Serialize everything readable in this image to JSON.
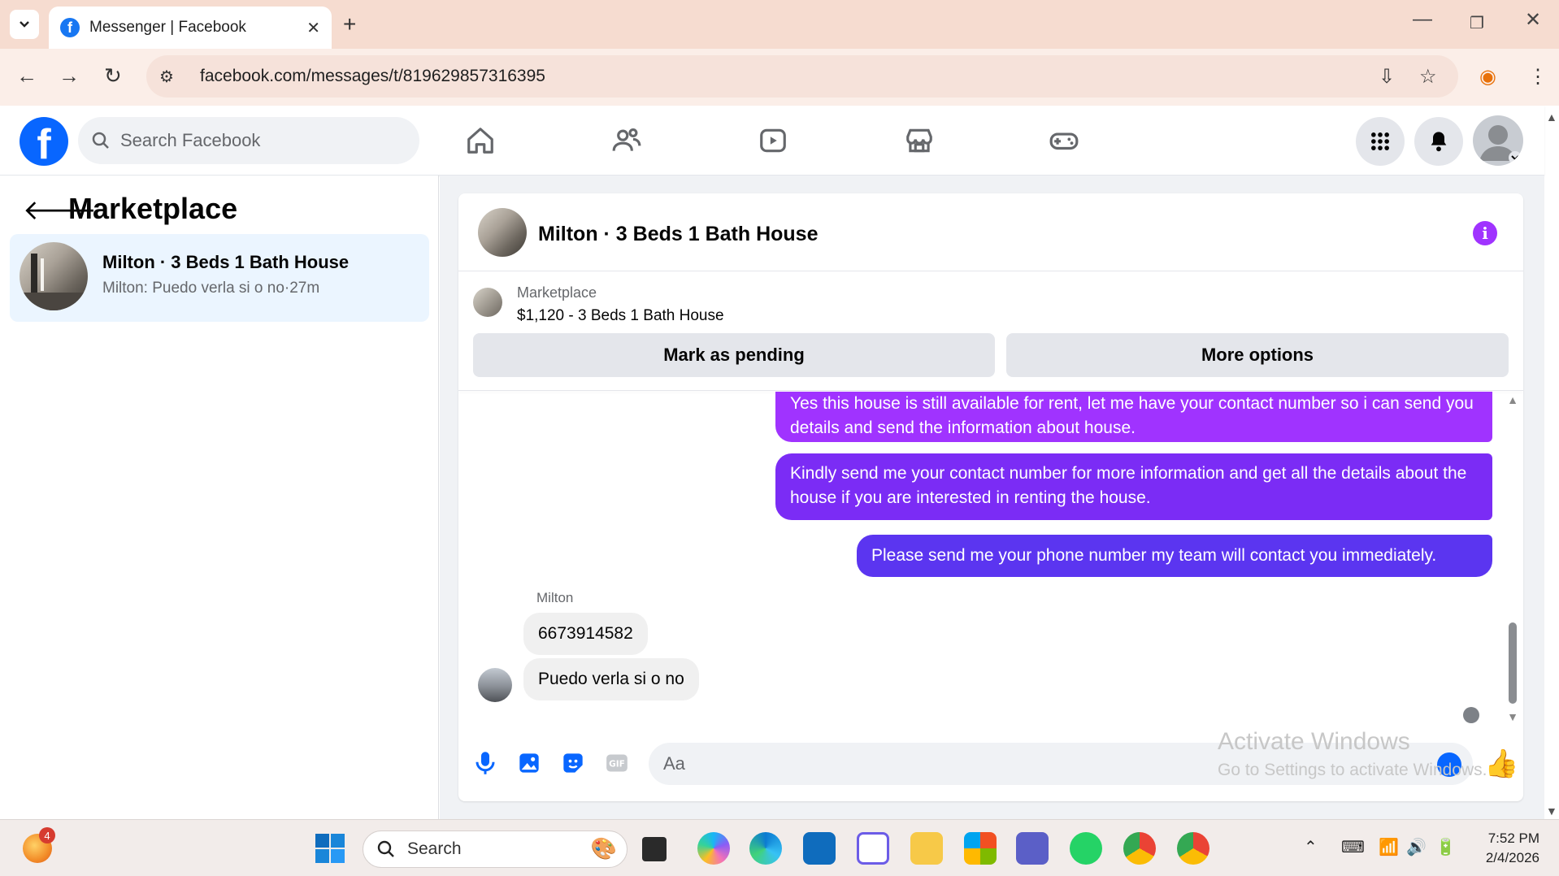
{
  "browser": {
    "tab_title": "Messenger | Facebook",
    "url": "facebook.com/messages/t/819629857316395"
  },
  "fb": {
    "search_placeholder": "Search Facebook",
    "logo_letter": "f"
  },
  "left_panel": {
    "title": "Marketplace",
    "conversation": {
      "name": "Milton · 3 Beds 1 Bath House",
      "preview": "Milton: Puedo verla si o no·27m"
    }
  },
  "chat": {
    "title": "Milton · 3 Beds 1 Bath House",
    "marketplace_label": "Marketplace",
    "listing": "$1,120 - 3 Beds 1 Bath House",
    "mark_pending": "Mark as pending",
    "more_options": "More options",
    "outgoing": [
      "Yes this house is still available for rent, let me have your contact number so i can send you details and send the information about house.",
      "Kindly send me your contact number for more information and get all the details about the house if you are interested in renting the house.",
      "Please send me your phone number my team will contact you immediately."
    ],
    "sender": "Milton",
    "incoming": [
      "6673914582",
      "Puedo verla si o no"
    ],
    "composer_placeholder": "Aa"
  },
  "watermark": {
    "line1": "Activate Windows",
    "line2": "Go to Settings to activate Windows."
  },
  "taskbar": {
    "search": "Search",
    "badge": "4",
    "time": "7:52 PM",
    "date": "2/4/2026"
  },
  "colors": {
    "fb_blue": "#0866ff",
    "bubble_purple": "#a033ff",
    "bubble_violet": "#7b2cf5",
    "bubble_indigo": "#5b35f0"
  }
}
